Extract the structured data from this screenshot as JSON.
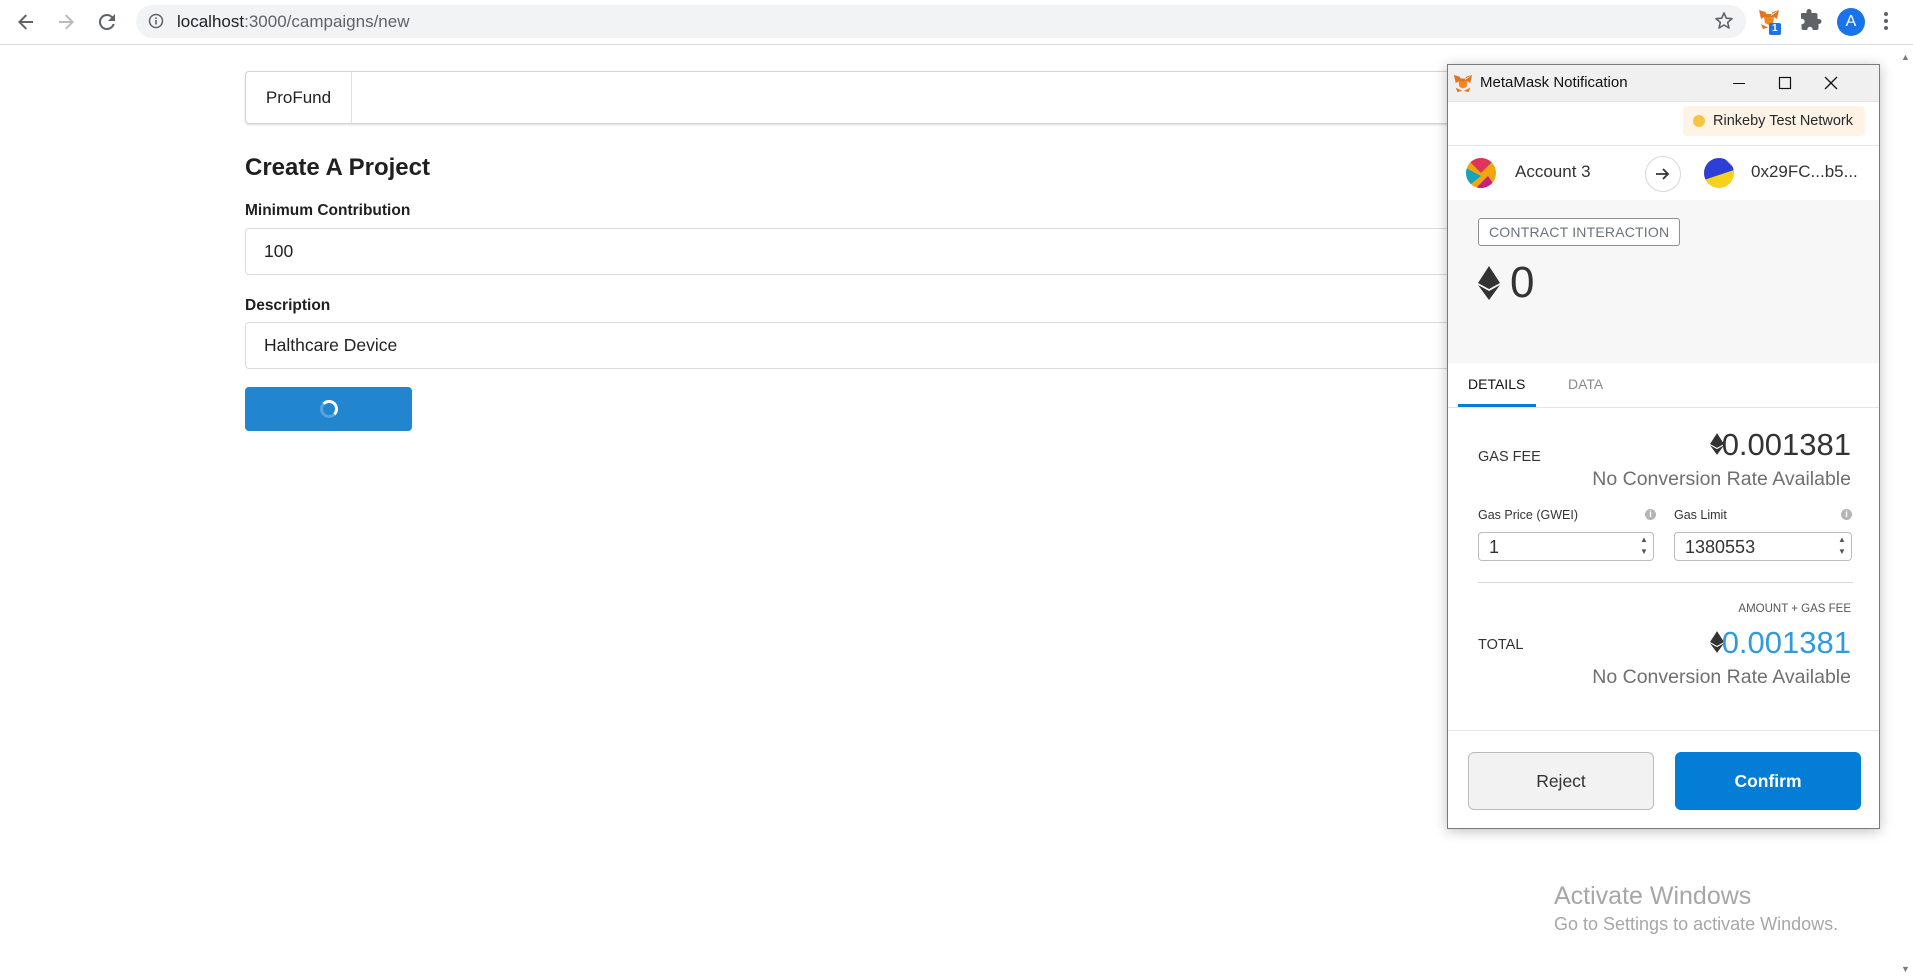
{
  "browser": {
    "url_host": "localhost",
    "url_path": ":3000/campaigns/new",
    "profile_initial": "A",
    "extension_badge": "1"
  },
  "page": {
    "brand": "ProFund",
    "title": "Create A Project",
    "min_contribution_label": "Minimum Contribution",
    "min_contribution_value": "100",
    "description_label": "Description",
    "description_value": "Halthcare Device"
  },
  "metamask": {
    "window_title": "MetaMask Notification",
    "network": "Rinkeby Test Network",
    "from_account": "Account 3",
    "to_address": "0x29FC...b5...",
    "badge": "CONTRACT INTERACTION",
    "amount": "0",
    "tabs": [
      "DETAILS",
      "DATA"
    ],
    "gas_fee_label": "GAS FEE",
    "gas_fee_value": "0.001381",
    "no_conversion": "No Conversion Rate Available",
    "gas_price_label": "Gas Price (GWEI)",
    "gas_price_value": "1",
    "gas_limit_label": "Gas Limit",
    "gas_limit_value": "1380553",
    "amount_gas_label": "AMOUNT + GAS FEE",
    "total_label": "TOTAL",
    "total_value": "0.001381",
    "reject_label": "Reject",
    "confirm_label": "Confirm",
    "accent_color": "#037dd6"
  },
  "watermark": {
    "title": "Activate Windows",
    "subtitle": "Go to Settings to activate Windows."
  }
}
